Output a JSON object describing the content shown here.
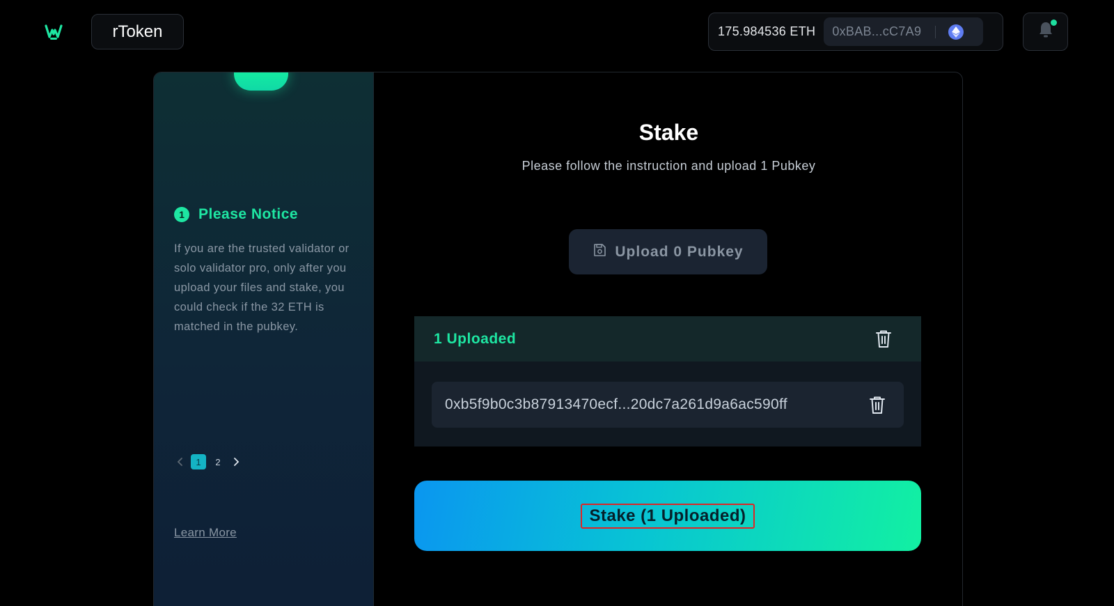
{
  "header": {
    "app_button_label": "rToken",
    "wallet": {
      "balance": "175.984536 ETH",
      "address": "0xBAB...cC7A9"
    }
  },
  "sidebar": {
    "notice": {
      "number": "1",
      "title": "Please Notice",
      "text": "If you are the trusted validator or solo validator pro, only after you upload your files and stake, you could check if the 32 ETH is matched in the pubkey."
    },
    "pager": {
      "pages": [
        "1",
        "2"
      ],
      "active_page": "1"
    },
    "learn_more_label": "Learn More"
  },
  "main": {
    "title": "Stake",
    "subtitle": "Please follow the instruction and upload 1 Pubkey",
    "upload_button_label": "Upload 0 Pubkey",
    "uploaded": {
      "header_label": "1 Uploaded",
      "keys": [
        "0xb5f9b0c3b87913470ecf...20dc7a261d9a6ac590ff"
      ]
    },
    "stake_button_label": "Stake (1 Uploaded)"
  },
  "colors": {
    "accent_green": "#1ee6a2",
    "stake_gradient_start": "#0a96f0",
    "stake_gradient_end": "#12f0a2",
    "highlight_border": "#e02424"
  },
  "icons": {
    "logo": "w-logo-icon",
    "eth": "ethereum-icon",
    "bell": "bell-icon",
    "upload": "file-upload-icon",
    "trash": "trash-icon"
  }
}
